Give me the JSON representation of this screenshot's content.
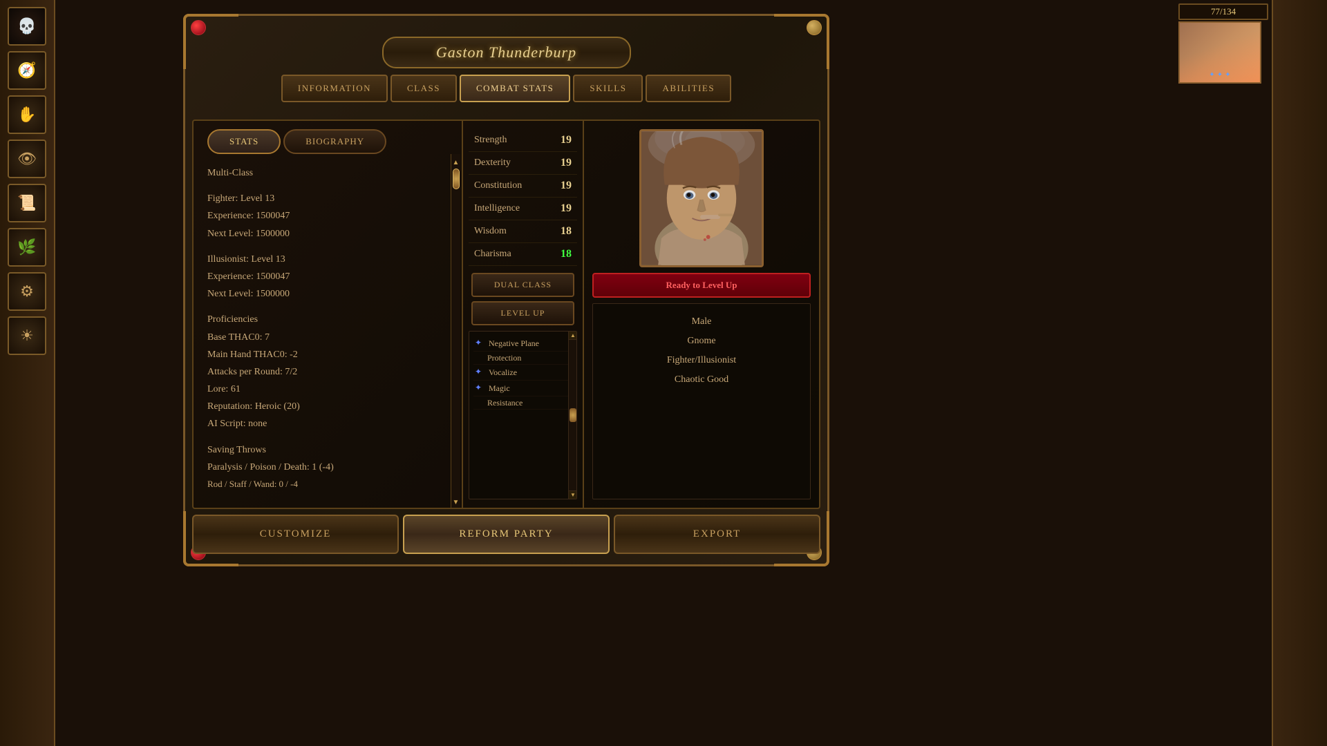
{
  "window": {
    "title": "Gaston Thunderburp"
  },
  "nav_tabs": [
    {
      "id": "information",
      "label": "INFORMATION",
      "active": false
    },
    {
      "id": "class",
      "label": "CLASS",
      "active": false
    },
    {
      "id": "combat_stats",
      "label": "COMBAT STATS",
      "active": false
    },
    {
      "id": "skills",
      "label": "SKILLS",
      "active": false
    },
    {
      "id": "abilities",
      "label": "ABILITIES",
      "active": false
    }
  ],
  "sub_tabs": [
    {
      "id": "stats",
      "label": "STATS",
      "active": true
    },
    {
      "id": "biography",
      "label": "BIOGRAPHY",
      "active": false
    }
  ],
  "character": {
    "class": "Multi-Class",
    "fighter_level": "Fighter: Level 13",
    "fighter_exp": "Experience: 1500047",
    "fighter_next": "Next Level: 1500000",
    "illusionist_level": "Illusionist: Level 13",
    "illusionist_exp": "Experience: 1500047",
    "illusionist_next": "Next Level: 1500000",
    "proficiencies": "Proficiencies",
    "thac0_base": "Base THAC0: 7",
    "thac0_main": "Main Hand THAC0: -2",
    "attacks": "Attacks per Round: 7/2",
    "lore": "Lore: 61",
    "reputation": "Reputation: Heroic (20)",
    "ai_script": "AI Script: none",
    "saving_throws": "Saving Throws",
    "paralysis": "Paralysis / Poison / Death: 1 (-4)",
    "rod_staff": "Rod / Staff / Wand: 0 / -4"
  },
  "attributes": [
    {
      "name": "Strength",
      "value": "19",
      "highlighted": false
    },
    {
      "name": "Dexterity",
      "value": "19",
      "highlighted": false
    },
    {
      "name": "Constitution",
      "value": "19",
      "highlighted": false
    },
    {
      "name": "Intelligence",
      "value": "19",
      "highlighted": false
    },
    {
      "name": "Wisdom",
      "value": "18",
      "highlighted": false
    },
    {
      "name": "Charisma",
      "value": "18",
      "highlighted": true
    }
  ],
  "buttons": {
    "dual_class": "DUAL CLASS",
    "level_up": "LEVEL UP",
    "ready_to_level_up": "Ready to Level Up"
  },
  "spells": [
    {
      "icon": "✦",
      "name": "Negative Plane Protection"
    },
    {
      "icon": "✦",
      "name": "Vocalize"
    },
    {
      "icon": "✦",
      "name": "Magic Resistance"
    }
  ],
  "char_info": {
    "gender": "Male",
    "race": "Gnome",
    "class": "Fighter/Illusionist",
    "alignment": "Chaotic Good"
  },
  "bottom_buttons": {
    "customize": "CUSTOMIZE",
    "reform_party": "REFORM PARTY",
    "export": "EXPORT"
  },
  "hp": {
    "current": "77",
    "max": "134"
  },
  "sidebar_icons": [
    "💀",
    "🧭",
    "✋",
    "👁️",
    "📖",
    "🌿",
    "⚙️",
    "☀️"
  ]
}
